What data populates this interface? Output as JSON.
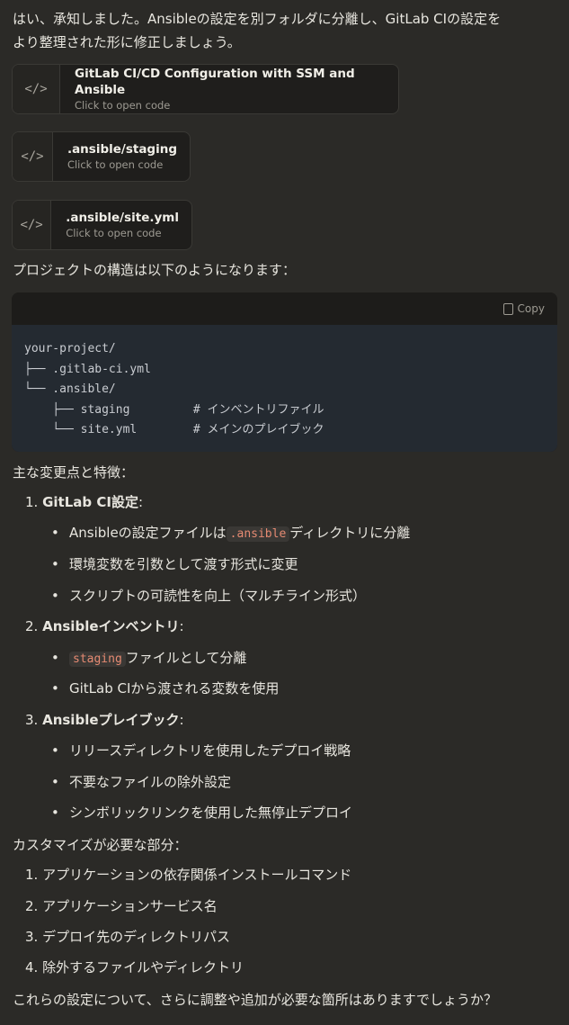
{
  "intro": {
    "line1": "はい、承知しました。Ansibleの設定を別フォルダに分離し、GitLab CIの設定を",
    "line2": "より整理された形に修正しましょう。"
  },
  "artifacts": [
    {
      "icon": "code-icon",
      "title": "GitLab CI/CD Configuration with SSM and Ansible",
      "subtitle": "Click to open code"
    },
    {
      "icon": "code-icon",
      "title": ".ansible/staging",
      "subtitle": "Click to open code"
    },
    {
      "icon": "code-icon",
      "title": ".ansible/site.yml",
      "subtitle": "Click to open code"
    }
  ],
  "structure_intro": "プロジェクトの構造は以下のようになります：",
  "code_block": {
    "copy_label": "Copy",
    "content": "your-project/\n├── .gitlab-ci.yml\n└── .ansible/\n    ├── staging         # インベントリファイル\n    └── site.yml        # メインのプレイブック"
  },
  "changes_heading": "主な変更点と特徴：",
  "sections": [
    {
      "number": "1.",
      "title": "GitLab CI設定",
      "colon": ":",
      "bullets": [
        {
          "pre": "Ansibleの設定ファイルは",
          "code": ".ansible",
          "post": "ディレクトリに分離"
        },
        {
          "pre": "環境変数を引数として渡す形式に変更",
          "code": "",
          "post": ""
        },
        {
          "pre": "スクリプトの可読性を向上（マルチライン形式）",
          "code": "",
          "post": ""
        }
      ]
    },
    {
      "number": "2.",
      "title": "Ansibleインベントリ",
      "colon": ":",
      "bullets": [
        {
          "pre": "",
          "code": "staging",
          "post": "ファイルとして分離"
        },
        {
          "pre": "GitLab CIから渡される変数を使用",
          "code": "",
          "post": ""
        }
      ]
    },
    {
      "number": "3.",
      "title": "Ansibleプレイブック",
      "colon": ":",
      "bullets": [
        {
          "pre": "リリースディレクトリを使用したデプロイ戦略",
          "code": "",
          "post": ""
        },
        {
          "pre": "不要なファイルの除外設定",
          "code": "",
          "post": ""
        },
        {
          "pre": "シンボリックリンクを使用した無停止デプロイ",
          "code": "",
          "post": ""
        }
      ]
    }
  ],
  "customize_heading": "カスタマイズが必要な部分：",
  "customize_items": [
    {
      "number": "1.",
      "text": "アプリケーションの依存関係インストールコマンド"
    },
    {
      "number": "2.",
      "text": "アプリケーションサービス名"
    },
    {
      "number": "3.",
      "text": "デプロイ先のディレクトリパス"
    },
    {
      "number": "4.",
      "text": "除外するファイルやディレクトリ"
    }
  ],
  "closing": "これらの設定について、さらに調整や追加が必要な箇所はありますでしょうか？"
}
